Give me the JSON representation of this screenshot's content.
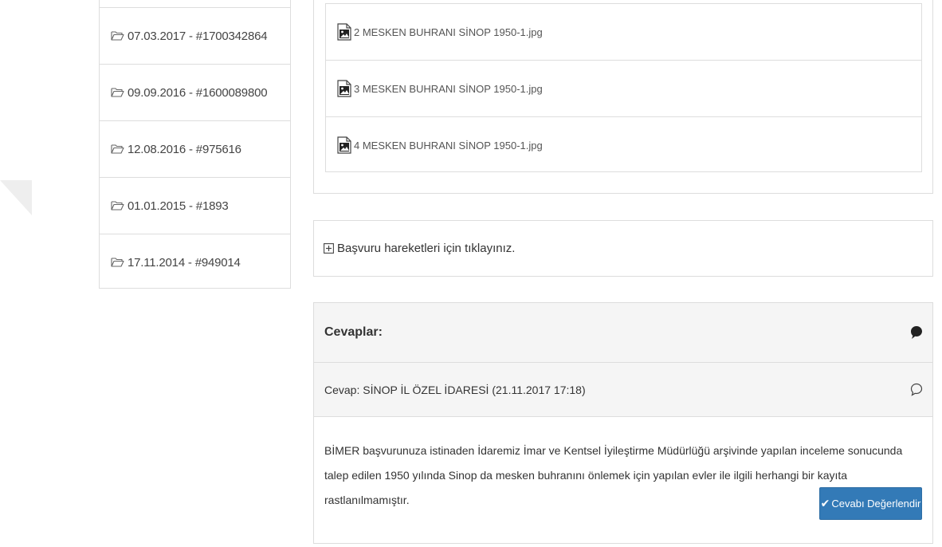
{
  "applications": [
    {
      "label": "07.03.2017 - #1700342864"
    },
    {
      "label": "09.09.2016 - #1600089800"
    },
    {
      "label": "12.08.2016 - #975616"
    },
    {
      "label": "01.01.2015 - #1893"
    },
    {
      "label": "17.11.2014 - #949014"
    }
  ],
  "attachments": [
    {
      "name": "2 MESKEN BUHRANI SİNOP 1950-1.jpg"
    },
    {
      "name": "3 MESKEN BUHRANI SİNOP 1950-1.jpg"
    },
    {
      "name": "4 MESKEN BUHRANI SİNOP 1950-1.jpg"
    }
  ],
  "history": {
    "label": "Başvuru hareketleri için tıklayınız."
  },
  "answers": {
    "title": "Cevaplar:",
    "answer_header": "Cevap: SİNOP İL ÖZEL İDARESİ (21.11.2017 17:18)",
    "answer_text": "BİMER başvurunuza istinaden İdaremiz İmar ve Kentsel İyileştirme Müdürlüğü arşivinde yapılan inceleme sonucunda talep edilen 1950 yılında Sinop da mesken buhranını önlemek için yapılan evler ile ilgili herhangi bir kayıta rastlanılmamıştır.",
    "rate_button": "Cevabı Değerlendir"
  },
  "colors": {
    "primary": "#337ab7",
    "border": "#dddddd",
    "panel_header": "#f5f5f5"
  }
}
